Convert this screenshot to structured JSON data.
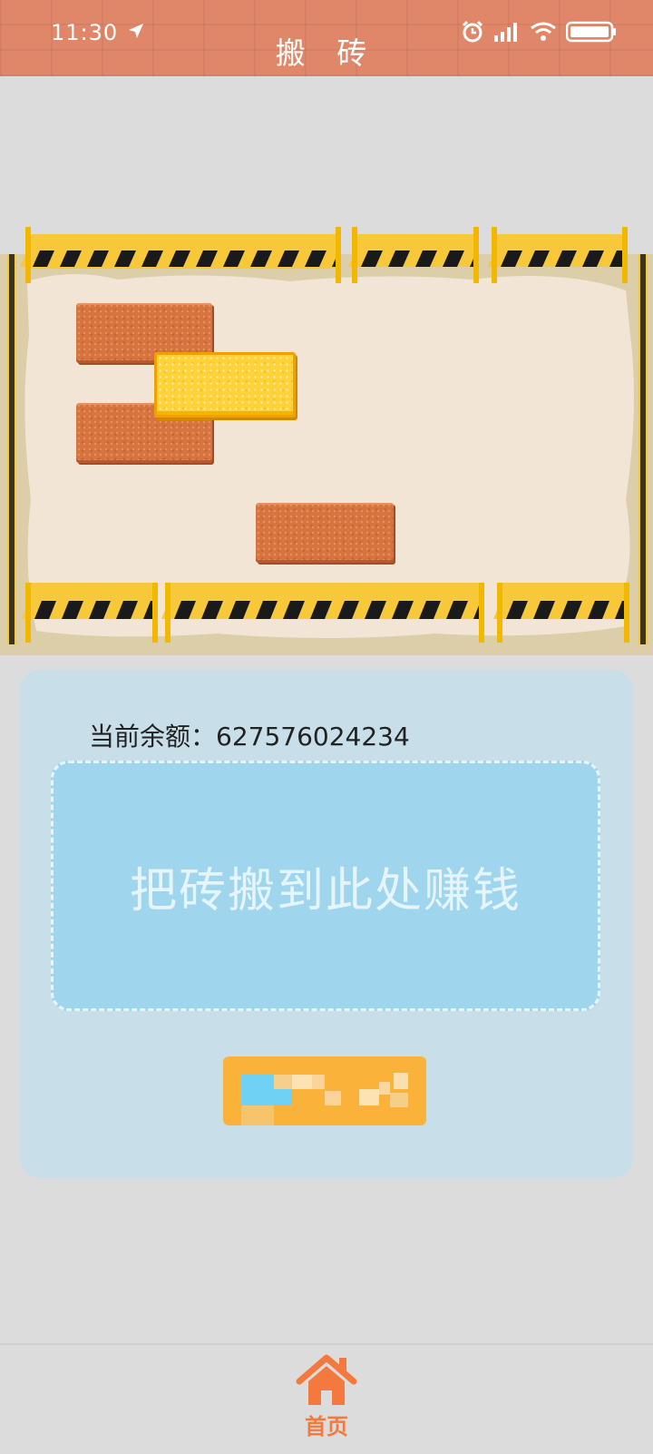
{
  "status_bar": {
    "time": "11:30"
  },
  "header": {
    "title": "搬 砖"
  },
  "panel": {
    "balance_label": "当前余额：627576024234",
    "drop_zone_text": "把砖搬到此处赚钱"
  },
  "nav": {
    "home_label": "首页"
  },
  "colors": {
    "header": "#e0876a",
    "accent": "#f4793e",
    "panel": "#c8dfe9",
    "drop_zone": "#9fd6ee",
    "button": "#fbb23a"
  },
  "icons": [
    "location-arrow-icon",
    "alarm-icon",
    "signal-icon",
    "wifi-icon",
    "battery-icon",
    "home-icon"
  ]
}
